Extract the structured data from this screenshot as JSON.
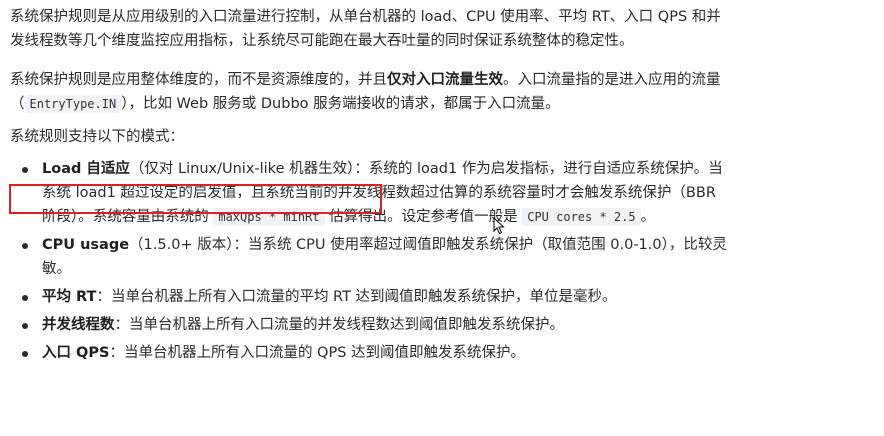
{
  "p1": "系统保护规则是从应用级别的入口流量进行控制，从单台机器的 load、CPU 使用率、平均 RT、入口 QPS 和并发线程数等几个维度监控应用指标，让系统尽可能跑在最大吞吐量的同时保证系统整体的稳定性。",
  "p2": {
    "t1": "系统保护规则是应用整体维度的，而不是资源维度的，并且",
    "bold": "仅对入口流量生效",
    "t2": "。入口流量指的是进入应用的流量（",
    "code": "EntryType.IN",
    "t3": "），比如 Web 服务或 Dubbo 服务端接收的请求，都属于入口流量。"
  },
  "p3": "系统规则支持以下的模式：",
  "items": [
    {
      "bold": "Load 自适应",
      "t1": "（仅对 Linux/Unix-like 机器生效）：系统的 load1 作为启发指标，进行自适应系统保护。当系统 load1 超过设定的启发值，且系统当前的并发线程数超过估算的系统容量时才会触发系统保护（BBR 阶段）。系统容量由系统的 ",
      "code1": "maxQps * minRt",
      "t2": " 估算得出。设定参考值一般是 ",
      "code2": "CPU cores * 2.5",
      "t3": "。"
    },
    {
      "bold": "CPU usage",
      "t1": "（1.5.0+ 版本）：当系统 CPU 使用率超过阈值即触发系统保护（取值范围 0.0-1.0），比较灵敏。"
    },
    {
      "bold": "平均 RT",
      "t1": "：当单台机器上所有入口流量的平均 RT 达到阈值即触发系统保护，单位是毫秒。"
    },
    {
      "bold": "并发线程数",
      "t1": "：当单台机器上所有入口流量的并发线程数达到阈值即触发系统保护。"
    },
    {
      "bold": "入口 QPS",
      "t1": "：当单台机器上所有入口流量的 QPS 达到阈值即触发系统保护。"
    }
  ],
  "colors": {
    "text": "#2b2b2b",
    "highlight_border": "#e02020",
    "code_bg": "#f1f2f4"
  }
}
